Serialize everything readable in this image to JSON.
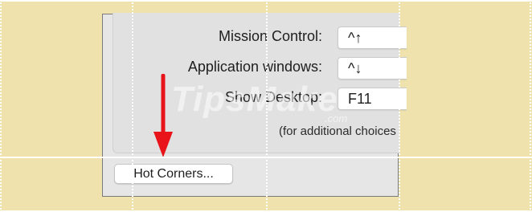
{
  "settings": {
    "rows": [
      {
        "label": "Mission Control:",
        "value": "^↑"
      },
      {
        "label": "Application windows:",
        "value": "^↓"
      },
      {
        "label": "Show Desktop:",
        "value": "F11"
      }
    ],
    "note": "(for additional choices"
  },
  "hot_corners_button": "Hot Corners...",
  "watermark": {
    "text": "TipsMake",
    "suffix": ".com"
  },
  "colors": {
    "background": "#efe2ad",
    "arrow": "#e8141a",
    "panel": "#e6e6e6"
  }
}
